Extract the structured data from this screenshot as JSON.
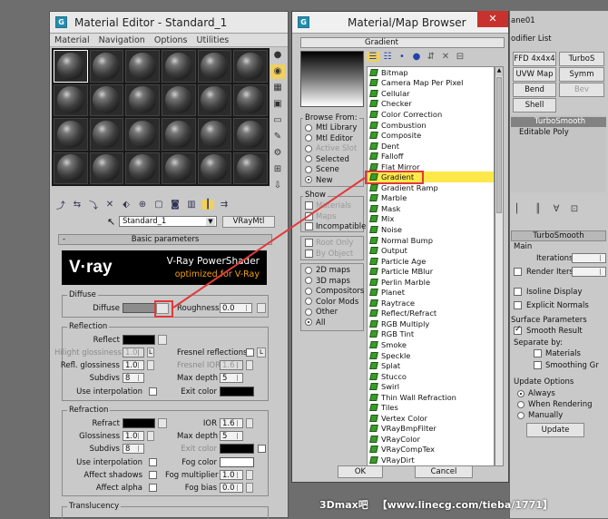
{
  "material_editor": {
    "title": "Material Editor - Standard_1",
    "menu": [
      "Material",
      "Navigation",
      "Options",
      "Utilities"
    ],
    "material_name": "Standard_1",
    "material_type": "VRayMtl",
    "rollout_title": "Basic parameters",
    "banner_logo": "V·ray",
    "banner_line1": "V-Ray PowerShader",
    "banner_line2": "optimized for V-Ray",
    "diffuse": {
      "group": "Diffuse",
      "label": "Diffuse",
      "roughness_label": "Roughness",
      "roughness_value": "0.0",
      "color": "#8c8c8c"
    },
    "reflection": {
      "group": "Reflection",
      "reflect_label": "Reflect",
      "hilight_label": "Hilight glossiness",
      "hilight_value": "1.0",
      "refl_gloss_label": "Refl. glossiness",
      "refl_gloss_value": "1.0",
      "subdivs_label": "Subdivs",
      "subdivs_value": "8",
      "use_interp_label": "Use interpolation",
      "fresnel_label": "Fresnel reflections",
      "fresnel_ior_label": "Fresnel IOR",
      "fresnel_ior_value": "1.6",
      "max_depth_label": "Max depth",
      "max_depth_value": "5",
      "exit_color_label": "Exit color",
      "l_button": "L"
    },
    "refraction": {
      "group": "Refraction",
      "refract_label": "Refract",
      "glossiness_label": "Glossiness",
      "glossiness_value": "1.0",
      "subdivs_label": "Subdivs",
      "subdivs_value": "8",
      "use_interp_label": "Use interpolation",
      "affect_shadows_label": "Affect shadows",
      "affect_alpha_label": "Affect alpha",
      "ior_label": "IOR",
      "ior_value": "1.6",
      "max_depth_label": "Max depth",
      "max_depth_value": "5",
      "exit_color_label": "Exit color",
      "fog_color_label": "Fog color",
      "fog_mult_label": "Fog multiplier",
      "fog_mult_value": "1.0",
      "fog_bias_label": "Fog bias",
      "fog_bias_value": "0.0"
    },
    "translucency_group": "Translucency"
  },
  "browser": {
    "title": "Material/Map Browser",
    "preview_name": "Gradient",
    "browse_from": {
      "label": "Browse From:",
      "options": [
        "Mtl Library",
        "Mtl Editor",
        "Active Slot",
        "Selected",
        "Scene",
        "New"
      ],
      "selected": "New"
    },
    "show": {
      "label": "Show",
      "options": [
        "Materials",
        "Maps",
        "Incompatible"
      ],
      "extra": [
        "Root Only",
        "By Object"
      ]
    },
    "filter": {
      "options": [
        "2D maps",
        "3D maps",
        "Compositors",
        "Color Mods",
        "Other",
        "All"
      ],
      "selected": "All"
    },
    "maps": [
      "Bitmap",
      "Camera Map Per Pixel",
      "Cellular",
      "Checker",
      "Color Correction",
      "Combustion",
      "Composite",
      "Dent",
      "Falloff",
      "Flat Mirror",
      "Gradient",
      "Gradient Ramp",
      "Marble",
      "Mask",
      "Mix",
      "Noise",
      "Normal Bump",
      "Output",
      "Particle Age",
      "Particle MBlur",
      "Perlin Marble",
      "Planet",
      "Raytrace",
      "Reflect/Refract",
      "RGB Multiply",
      "RGB Tint",
      "Smoke",
      "Speckle",
      "Splat",
      "Stucco",
      "Swirl",
      "Thin Wall Refraction",
      "Tiles",
      "Vertex Color",
      "VRayBmpFilter",
      "VRayColor",
      "VRayCompTex",
      "VRayDirt"
    ],
    "selected_map": "Gradient",
    "ok_label": "OK",
    "cancel_label": "Cancel",
    "close_label": "✕"
  },
  "modifier_panel": {
    "name_fragment": "ane01",
    "modifier_list": "odifier List",
    "buttons": [
      "FFD 4x4x4",
      "TurboS",
      "UVW Map",
      "Symm",
      "Bend",
      "Bev",
      "Shell"
    ],
    "stack": [
      "TurboSmooth",
      "Editable Poly"
    ],
    "rollout": "TurboSmooth",
    "main_label": "Main",
    "iterations_label": "Iterations:",
    "render_iters_label": "Render Iters:",
    "isoline_label": "Isoline Display",
    "explicit_normals_label": "Explicit Normals",
    "surface_params_label": "Surface Parameters",
    "smooth_result_label": "Smooth Result",
    "separate_by_label": "Separate by:",
    "materials_label": "Materials",
    "smoothing_label": "Smoothing Gr",
    "update_options_label": "Update Options",
    "always_label": "Always",
    "when_rendering_label": "When Rendering",
    "manually_label": "Manually",
    "update_button": "Update"
  },
  "watermark": {
    "brand": "3Dmax吧",
    "url": "【www.linecg.com/tieba/1771】"
  },
  "colors": {
    "highlight": "#e03a3a",
    "selection": "#ffe84a",
    "map_icon": "#3a9a2a"
  }
}
